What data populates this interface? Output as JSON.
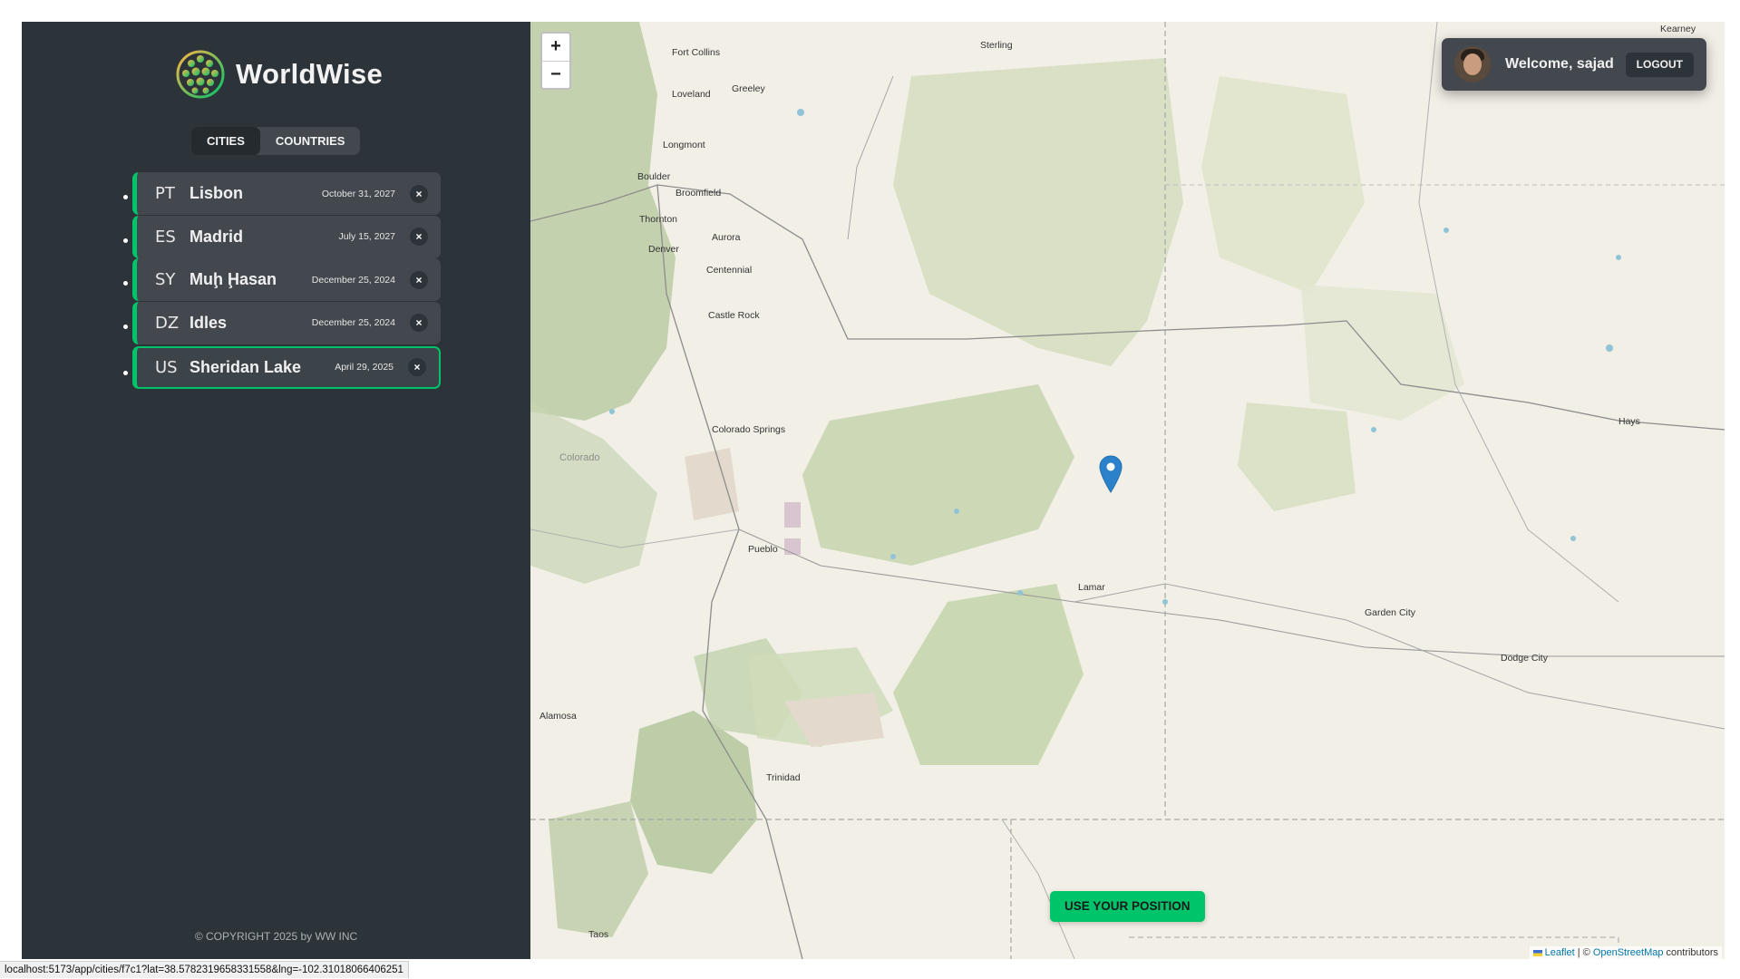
{
  "app": {
    "name": "WorldWise"
  },
  "nav": {
    "tabs": [
      "CITIES",
      "COUNTRIES"
    ],
    "active": "CITIES"
  },
  "cities": [
    {
      "flag": "PT",
      "name": "Lisbon",
      "date": "October 31, 2027",
      "delete": "×",
      "active": false
    },
    {
      "flag": "ES",
      "name": "Madrid",
      "date": "July 15, 2027",
      "delete": "×",
      "active": false
    },
    {
      "flag": "SY",
      "name": "Muḩ Ḩasan",
      "date": "December 25, 2024",
      "delete": "×",
      "active": false
    },
    {
      "flag": "DZ",
      "name": "Idles",
      "date": "December 25, 2024",
      "delete": "×",
      "active": false
    },
    {
      "flag": "US",
      "name": "Sheridan Lake",
      "date": "April 29, 2025",
      "delete": "×",
      "active": true
    }
  ],
  "footer": {
    "copyright": "© COPYRIGHT 2025 by WW INC"
  },
  "map": {
    "zoom_in": "+",
    "zoom_out": "−",
    "user": {
      "welcome": "Welcome, sajad",
      "logout": "LOGOUT"
    },
    "position_button": "USE YOUR POSITION",
    "attribution": {
      "leaflet": "Leaflet",
      "sep": " | © ",
      "osm": "OpenStreetMap",
      "suffix": " contributors"
    },
    "places": [
      "Kearney",
      "Sterling",
      "Fort Collins",
      "Loveland",
      "Greeley",
      "Longmont",
      "Boulder",
      "Broomfield",
      "Thornton",
      "Aurora",
      "Denver",
      "Centennial",
      "Castle Rock",
      "Colorado Springs",
      "Colorado",
      "Hays",
      "Pueblo",
      "Lamar",
      "Garden City",
      "Dodge City",
      "Alamosa",
      "Trinidad",
      "Taos"
    ]
  },
  "status_url": "localhost:5173/app/cities/f7c1?lat=38.5782319658331558&lng=-102.31018066406251",
  "colors": {
    "brand": "#00c46a",
    "sidebar": "#2d3439",
    "card": "#42484d"
  }
}
